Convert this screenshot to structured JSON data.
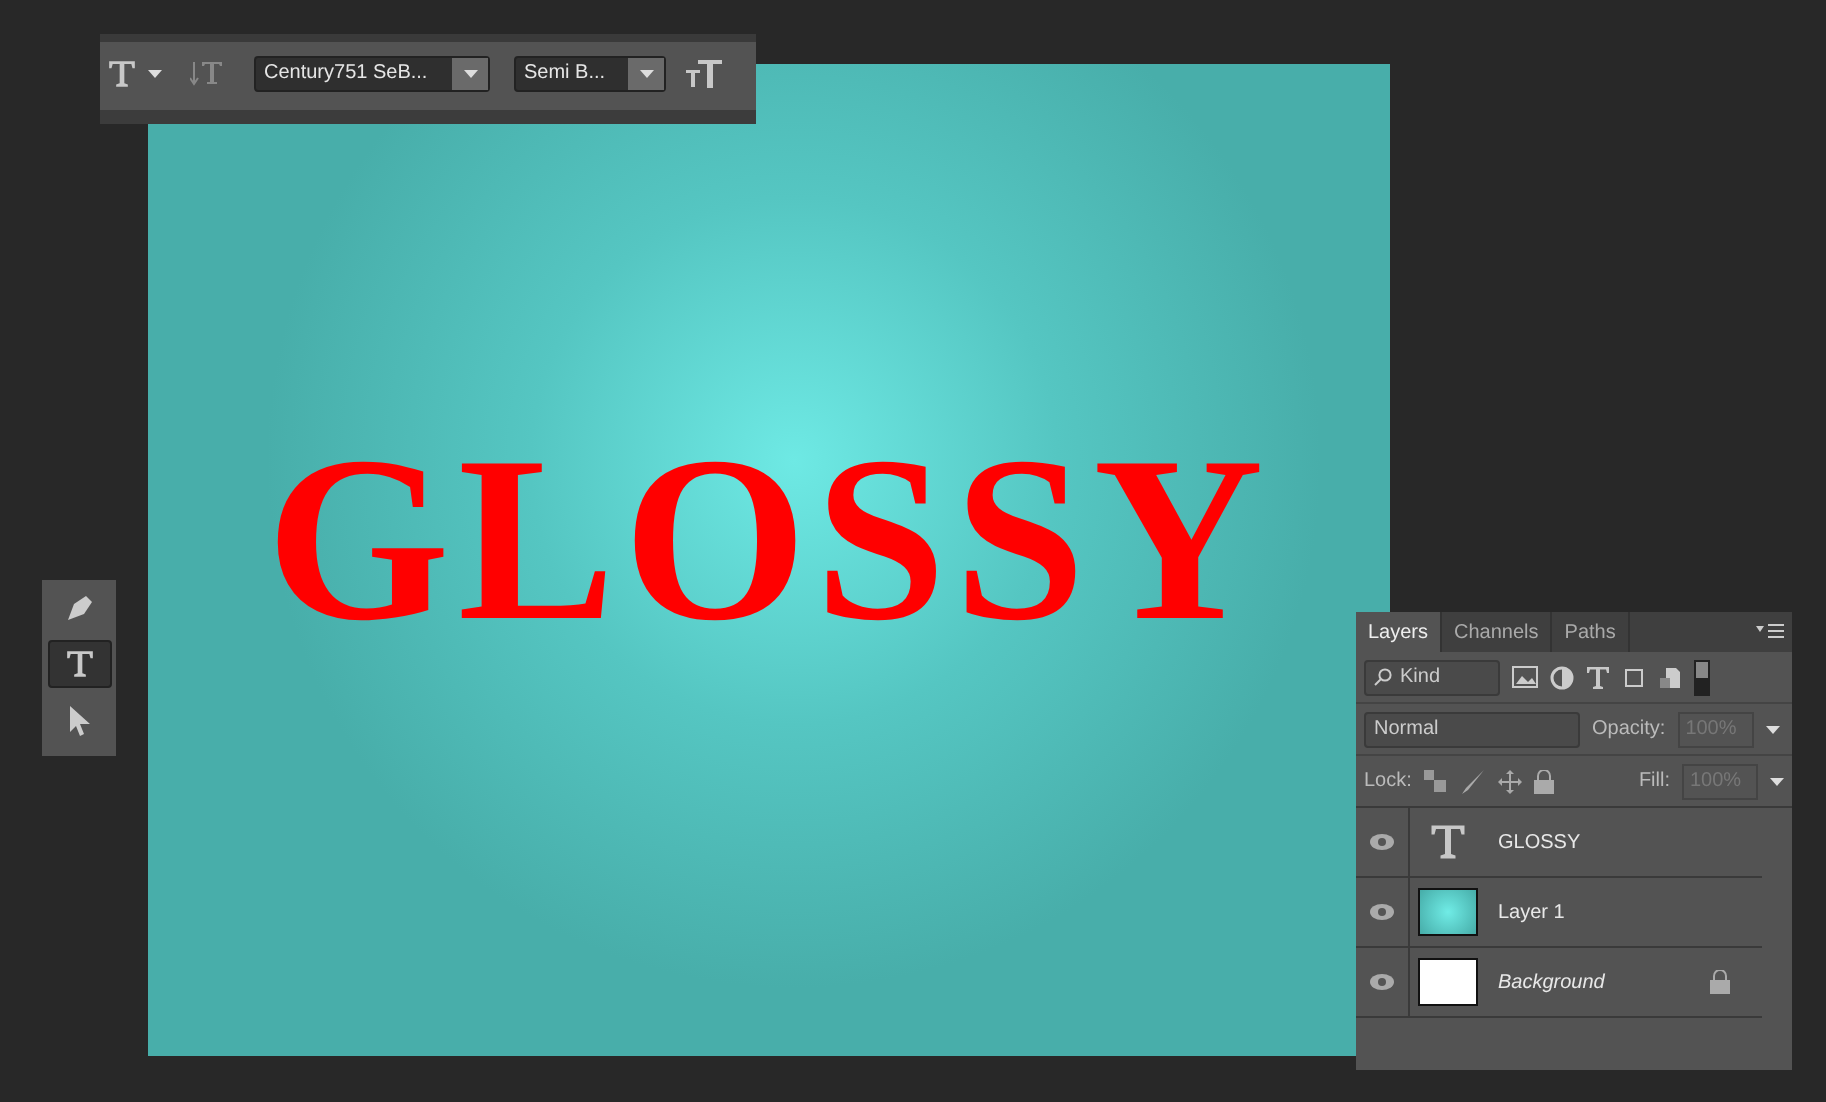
{
  "options_bar": {
    "font_family": "Century751 SeB...",
    "font_style": "Semi B..."
  },
  "canvas": {
    "text": "GLOSSY"
  },
  "tools": [
    {
      "kind": "pen",
      "selected": false
    },
    {
      "kind": "type",
      "selected": true
    },
    {
      "kind": "select",
      "selected": false
    }
  ],
  "layers_panel": {
    "tabs": [
      {
        "label": "Layers",
        "selected": true
      },
      {
        "label": "Channels",
        "selected": false
      },
      {
        "label": "Paths",
        "selected": false
      }
    ],
    "filter": "Kind",
    "blend_mode": "Normal",
    "opacity_label": "Opacity:",
    "opacity": "100%",
    "lock_label": "Lock:",
    "fill_label": "Fill:",
    "fill": "100%",
    "layers": [
      {
        "name": "GLOSSY",
        "kind": "text",
        "locked": false,
        "italic": false
      },
      {
        "name": "Layer 1",
        "kind": "gradient",
        "locked": false,
        "italic": false
      },
      {
        "name": "Background",
        "kind": "white",
        "locked": true,
        "italic": true
      }
    ]
  }
}
